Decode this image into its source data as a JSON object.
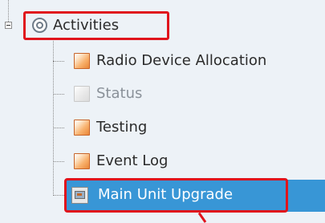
{
  "tree": {
    "root": {
      "label": "Activities",
      "icon": "gear-icon",
      "expander": "collapse",
      "highlighted": true
    },
    "items": [
      {
        "label": "Radio Device Allocation",
        "icon": "activity-icon",
        "enabled": true
      },
      {
        "label": "Status",
        "icon": "activity-icon",
        "enabled": false
      },
      {
        "label": "Testing",
        "icon": "activity-icon",
        "enabled": true
      },
      {
        "label": "Event Log",
        "icon": "activity-icon",
        "enabled": true
      },
      {
        "label": "Main Unit Upgrade",
        "icon": "upgrade-icon",
        "enabled": true,
        "selected": true,
        "highlighted": true
      }
    ]
  },
  "colors": {
    "background": "#edf2f7",
    "selection": "#3896d6",
    "highlight": "#e0141c",
    "disabled_text": "#8a9199"
  }
}
